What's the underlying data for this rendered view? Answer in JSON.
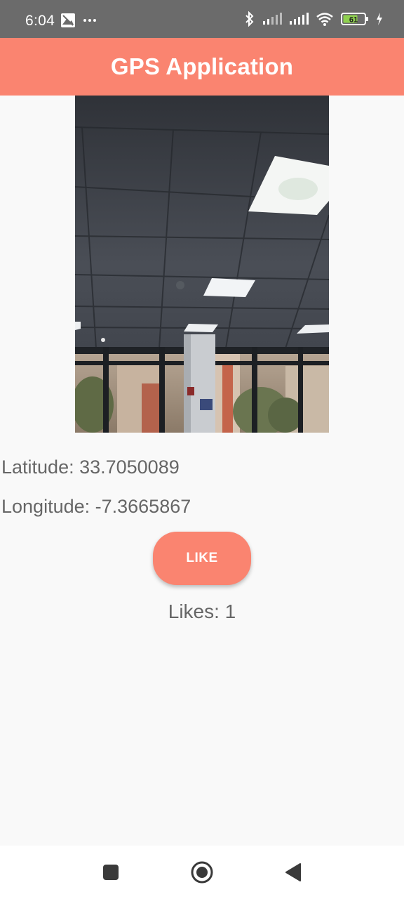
{
  "status_bar": {
    "time": "6:04",
    "icons": [
      "gallery-notification-icon",
      "more-dots-icon",
      "bluetooth-icon",
      "signal-icon",
      "signal-icon",
      "wifi-icon",
      "battery-icon",
      "charging-icon"
    ],
    "battery_level": "61"
  },
  "app_bar": {
    "title": "GPS Application"
  },
  "location": {
    "latitude_text": "Latitude: 33.7050089",
    "longitude_text": "Longitude: -7.3665867"
  },
  "like": {
    "button_label": "LIKE",
    "count_text": "Likes: 1"
  },
  "colors": {
    "accent": "#fa8470",
    "status_bar": "#6b6b6b",
    "text": "#666666"
  },
  "nav_bar": {
    "buttons": [
      "recents-square-icon",
      "home-circle-icon",
      "back-triangle-icon"
    ]
  }
}
